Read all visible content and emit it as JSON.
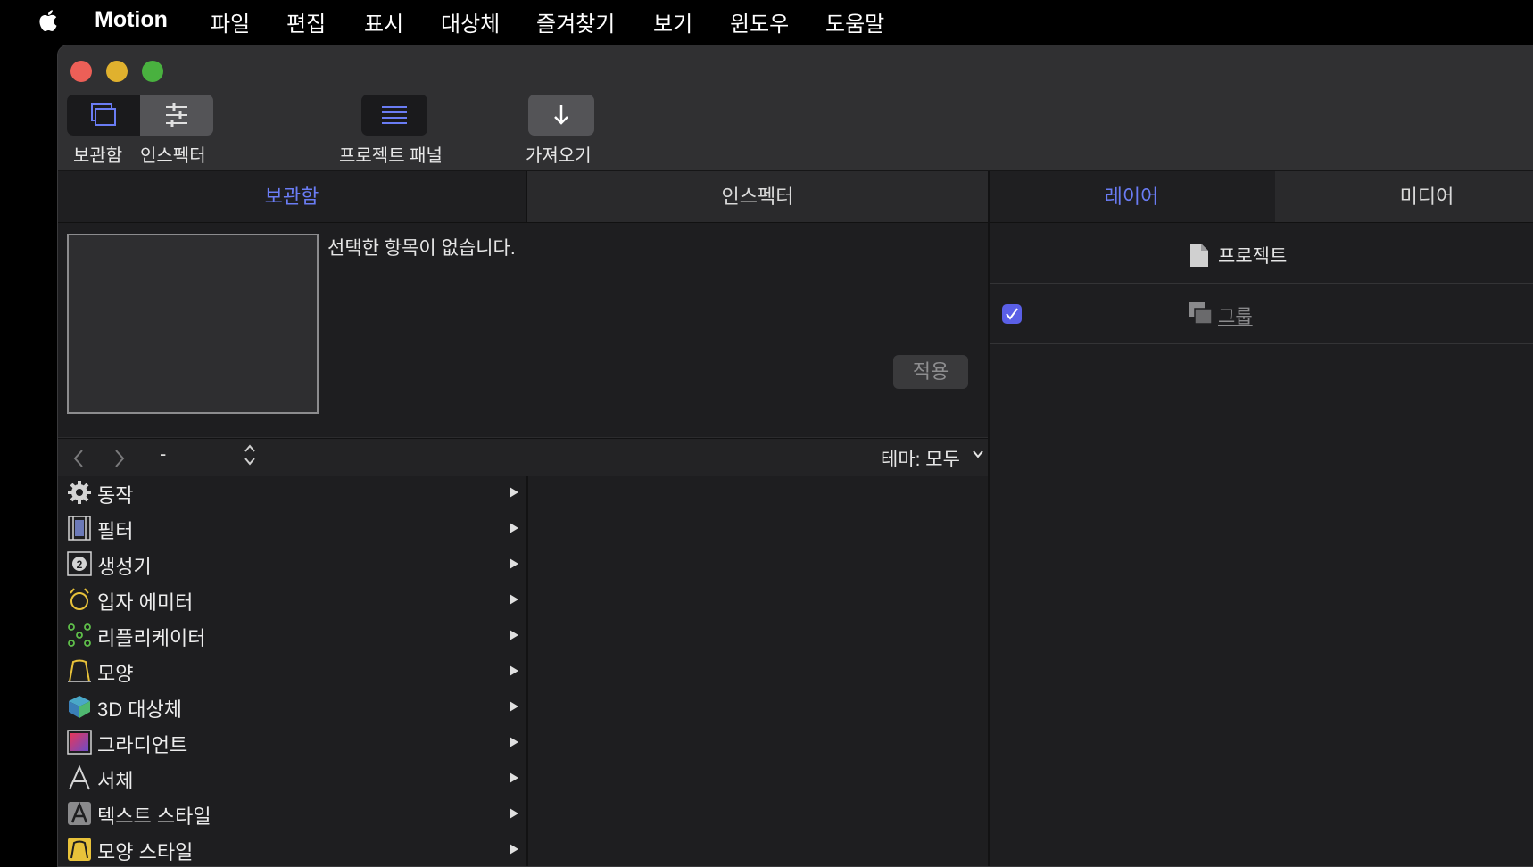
{
  "menubar": {
    "app_name": "Motion",
    "items": [
      "파일",
      "편집",
      "표시",
      "대상체",
      "즐겨찾기",
      "보기",
      "윈도우",
      "도움말"
    ]
  },
  "toolbar": {
    "library_label": "보관함",
    "inspector_label": "인스펙터",
    "project_panel_label": "프로젝트 패널",
    "import_label": "가져오기"
  },
  "left_tabs": {
    "library": "보관함",
    "inspector": "인스펙터"
  },
  "right_tabs": {
    "layers": "레이어",
    "media": "미디어"
  },
  "preview": {
    "no_selection": "선택한 항목이 없습니다.",
    "apply_label": "적용"
  },
  "navbar": {
    "path_value": "-",
    "theme_label": "테마: 모두"
  },
  "library_items": [
    {
      "label": "동작",
      "icon": "gear-icon"
    },
    {
      "label": "필터",
      "icon": "film-icon"
    },
    {
      "label": "생성기",
      "icon": "generator-icon"
    },
    {
      "label": "입자 에미터",
      "icon": "particle-icon"
    },
    {
      "label": "리플리케이터",
      "icon": "replicator-icon"
    },
    {
      "label": "모양",
      "icon": "shape-icon"
    },
    {
      "label": "3D 대상체",
      "icon": "cube-icon"
    },
    {
      "label": "그라디언트",
      "icon": "gradient-icon"
    },
    {
      "label": "서체",
      "icon": "font-icon"
    },
    {
      "label": "텍스트 스타일",
      "icon": "text-style-icon"
    },
    {
      "label": "모양 스타일",
      "icon": "shape-style-icon"
    }
  ],
  "layers": {
    "project_label": "프로젝트",
    "group_label": "그룹",
    "group_checked": true
  },
  "colors": {
    "accent": "#6a7cf4",
    "checkbox": "#5a5fe6",
    "close": "#ec5f57",
    "minimize": "#e0b12e",
    "maximize": "#49b13f"
  }
}
